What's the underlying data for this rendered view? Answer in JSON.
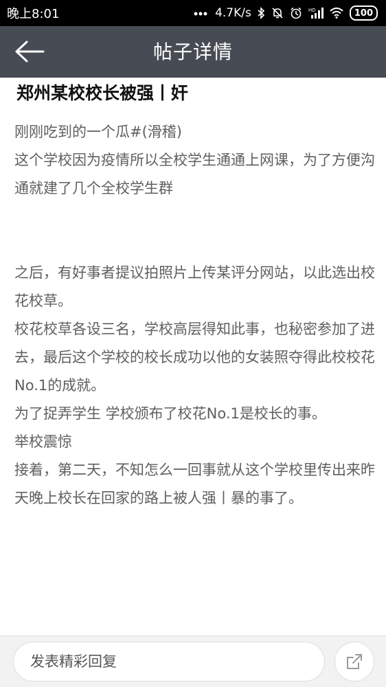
{
  "status_bar": {
    "time": "晚上8:01",
    "net_speed": "4.7K/s",
    "battery": "100",
    "icons": [
      "signal-dots-icon",
      "bluetooth-icon",
      "mute-icon",
      "alarm-icon",
      "hd-signal-icon",
      "wifi-icon",
      "battery-icon"
    ]
  },
  "header": {
    "title": "帖子详情",
    "back_icon": "back-arrow-icon"
  },
  "post": {
    "title": "郑州某校校长被强丨奸",
    "paragraphs": [
      "刚刚吃到的一个瓜#(滑稽)",
      "这个学校因为疫情所以全校学生通通上网课，为了方便沟通就建了几个全校学生群",
      "",
      "之后，有好事者提议拍照片上传某评分网站，以此选出校花校草。",
      "校花校草各设三名，学校高层得知此事，也秘密参加了进去，最后这个学校的校长成功以他的女装照夺得此校校花No.1的成就。",
      "为了捉弄学生 学校颁布了校花No.1是校长的事。",
      "举校震惊",
      "接着，第二天，不知怎么一回事就从这个学校里传出来昨天晚上校长在回家的路上被人强丨暴的事了。"
    ]
  },
  "bottom_bar": {
    "reply_placeholder": "发表精彩回复",
    "share_icon": "share-icon"
  }
}
